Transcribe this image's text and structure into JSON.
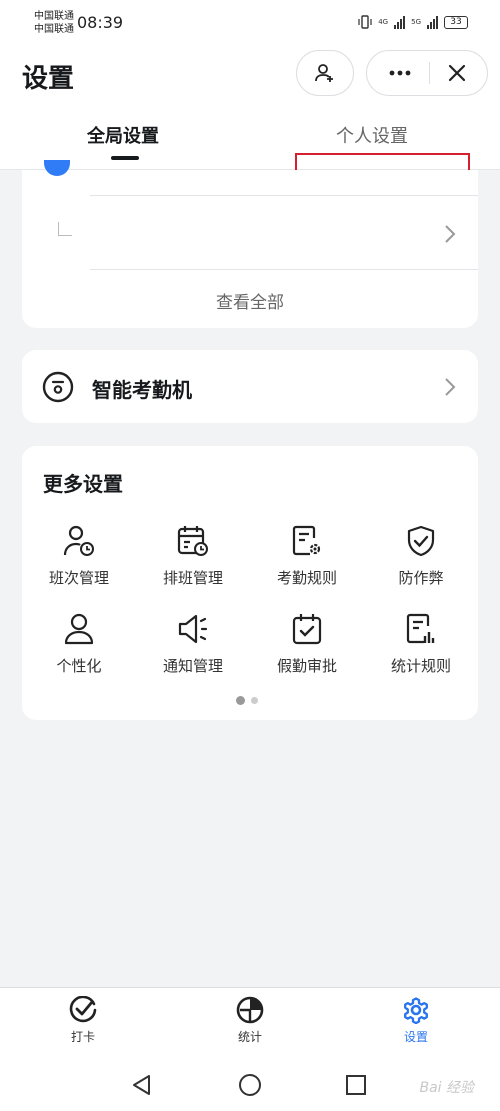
{
  "status_bar": {
    "carrier_line1": "中国联通",
    "carrier_line2": "中国联通",
    "time": "08:39",
    "net1": "4G",
    "net2": "5G",
    "battery": "33"
  },
  "header": {
    "title": "设置"
  },
  "tabs": [
    {
      "label": "全局设置",
      "active": true
    },
    {
      "label": "个人设置",
      "active": false
    }
  ],
  "top_card": {
    "view_all": "查看全部"
  },
  "machine": {
    "label": "智能考勤机"
  },
  "more_settings": {
    "title": "更多设置",
    "items": [
      {
        "label": "班次管理",
        "icon": "shift-management-icon"
      },
      {
        "label": "排班管理",
        "icon": "schedule-management-icon"
      },
      {
        "label": "考勤规则",
        "icon": "attendance-rules-icon"
      },
      {
        "label": "防作弊",
        "icon": "anti-cheat-icon"
      },
      {
        "label": "个性化",
        "icon": "personalize-icon"
      },
      {
        "label": "通知管理",
        "icon": "notification-icon"
      },
      {
        "label": "假勤审批",
        "icon": "leave-approval-icon"
      },
      {
        "label": "统计规则",
        "icon": "statistics-rules-icon"
      }
    ],
    "page_index": 1,
    "page_count": 2
  },
  "bottom_nav": [
    {
      "label": "打卡",
      "icon": "check-in-icon",
      "active": false
    },
    {
      "label": "统计",
      "icon": "statistics-icon",
      "active": false
    },
    {
      "label": "设置",
      "icon": "gear-icon",
      "active": true
    }
  ],
  "watermark": "Bai 经验",
  "colors": {
    "accent": "#2a74f0",
    "highlight_box": "#d42030",
    "background": "#f2f3f5"
  }
}
